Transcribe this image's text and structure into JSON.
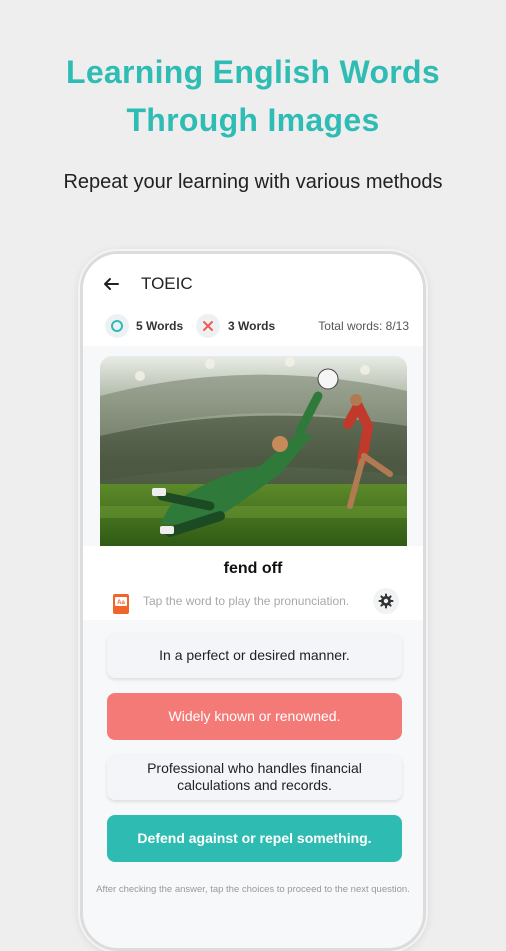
{
  "promo": {
    "headline_line1": "Learning English Words",
    "headline_line2": "Through Images",
    "subhead": "Repeat your learning with various methods"
  },
  "app": {
    "title": "TOEIC",
    "stats": {
      "correct_label": "5 Words",
      "wrong_label": "3 Words",
      "total_label": "Total words: 8/13"
    },
    "card": {
      "image_icon": "soccer-goalkeeper-photo",
      "word": "fend off",
      "hint": "Tap the word to play the pronunciation."
    },
    "choices": [
      {
        "text": "In a perfect or desired manner.",
        "state": "normal"
      },
      {
        "text": "Widely known or renowned.",
        "state": "wrong"
      },
      {
        "text": "Professional who handles financial calculations and records.",
        "state": "normal"
      },
      {
        "text": "Defend against or repel something.",
        "state": "correct"
      }
    ],
    "footer_note": "After checking the answer, tap the choices to proceed to the next question."
  },
  "colors": {
    "accent": "#2fbcb4",
    "wrong": "#f47a77",
    "correct": "#2ebcb2"
  }
}
